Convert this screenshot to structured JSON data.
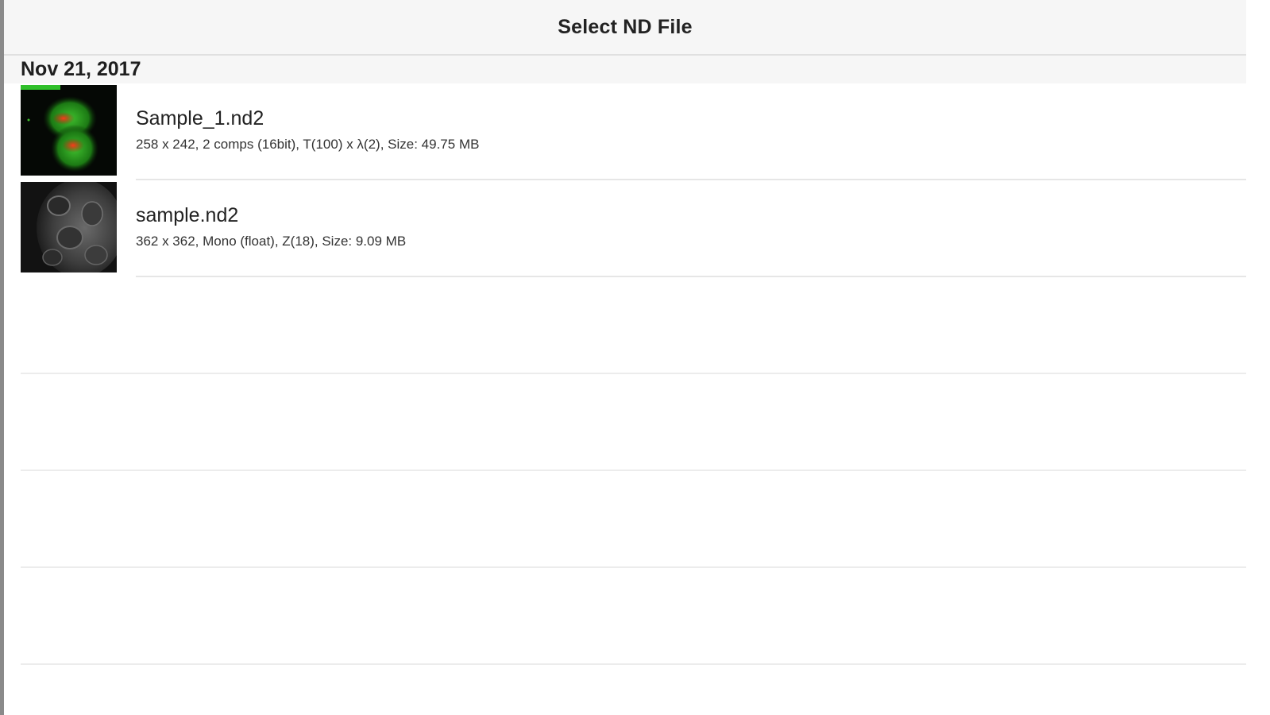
{
  "nav": {
    "title": "Select ND File"
  },
  "section": {
    "date": "Nov 21, 2017"
  },
  "files": [
    {
      "name": "Sample_1.nd2",
      "details": "258 x 242, 2 comps (16bit), T(100) x λ(2), Size: 49.75 MB",
      "thumbnail": "fluorescence-green-red"
    },
    {
      "name": "sample.nd2",
      "details": "362 x 362, Mono (float), Z(18), Size: 9.09 MB",
      "thumbnail": "grayscale-cells"
    }
  ],
  "colors": {
    "nav_background": "#f6f6f6",
    "separator": "#e6e6e6",
    "window_edge": "#8a8a8a"
  }
}
